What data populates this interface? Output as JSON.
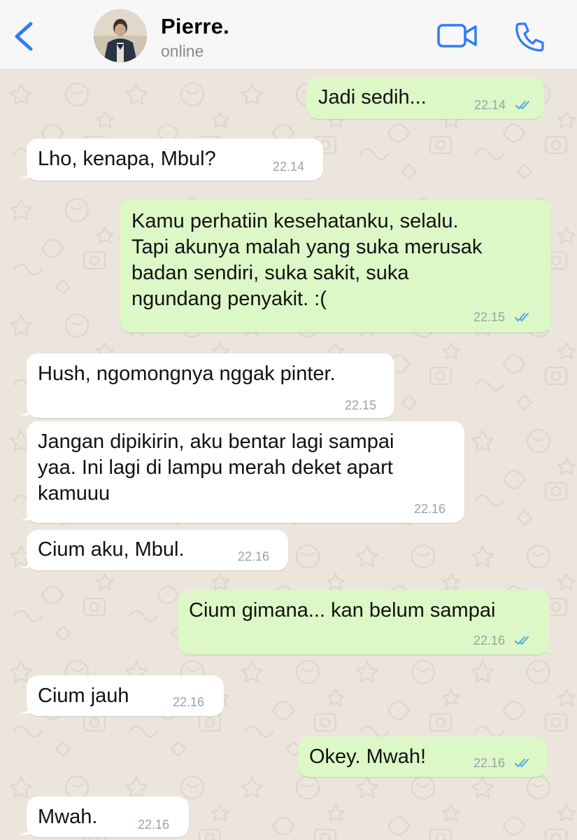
{
  "header": {
    "contact_name": "Pierre.",
    "status": "online",
    "icons": {
      "back": "chevron-left-icon",
      "video": "video-call-icon",
      "phone": "phone-icon"
    },
    "accent_color": "#2f7cf6"
  },
  "messages": [
    {
      "direction": "outgoing",
      "text": "Jadi sedih...",
      "time": "22.14",
      "read": true
    },
    {
      "direction": "incoming",
      "text": "Lho, kenapa, Mbul?",
      "time": "22.14"
    },
    {
      "direction": "outgoing",
      "text": "Kamu perhatiin kesehatanku, selalu.\nTapi akunya malah yang suka merusak\nbadan sendiri, suka sakit, suka\nngundang penyakit. :(",
      "time": "22.15",
      "read": true
    },
    {
      "direction": "incoming",
      "text": "Hush, ngomongnya nggak pinter.",
      "time": "22.15"
    },
    {
      "direction": "incoming",
      "text": "Jangan dipikirin, aku bentar lagi sampai\nyaa. Ini lagi di lampu merah deket apart\nkamuuu",
      "time": "22.16"
    },
    {
      "direction": "incoming",
      "text": "Cium aku, Mbul.",
      "time": "22.16"
    },
    {
      "direction": "outgoing",
      "text": "Cium gimana... kan belum sampai",
      "time": "22.16",
      "read": true
    },
    {
      "direction": "incoming",
      "text": "Cium jauh",
      "time": "22.16"
    },
    {
      "direction": "outgoing",
      "text": "Okey. Mwah!",
      "time": "22.16",
      "read": true
    },
    {
      "direction": "incoming",
      "text": "Mwah.",
      "time": "22.16"
    }
  ],
  "colors": {
    "incoming_bubble": "#ffffff",
    "outgoing_bubble": "#dcf8c6",
    "read_ticks": "#4fa6e8",
    "timestamp": "#9aa3a8"
  }
}
